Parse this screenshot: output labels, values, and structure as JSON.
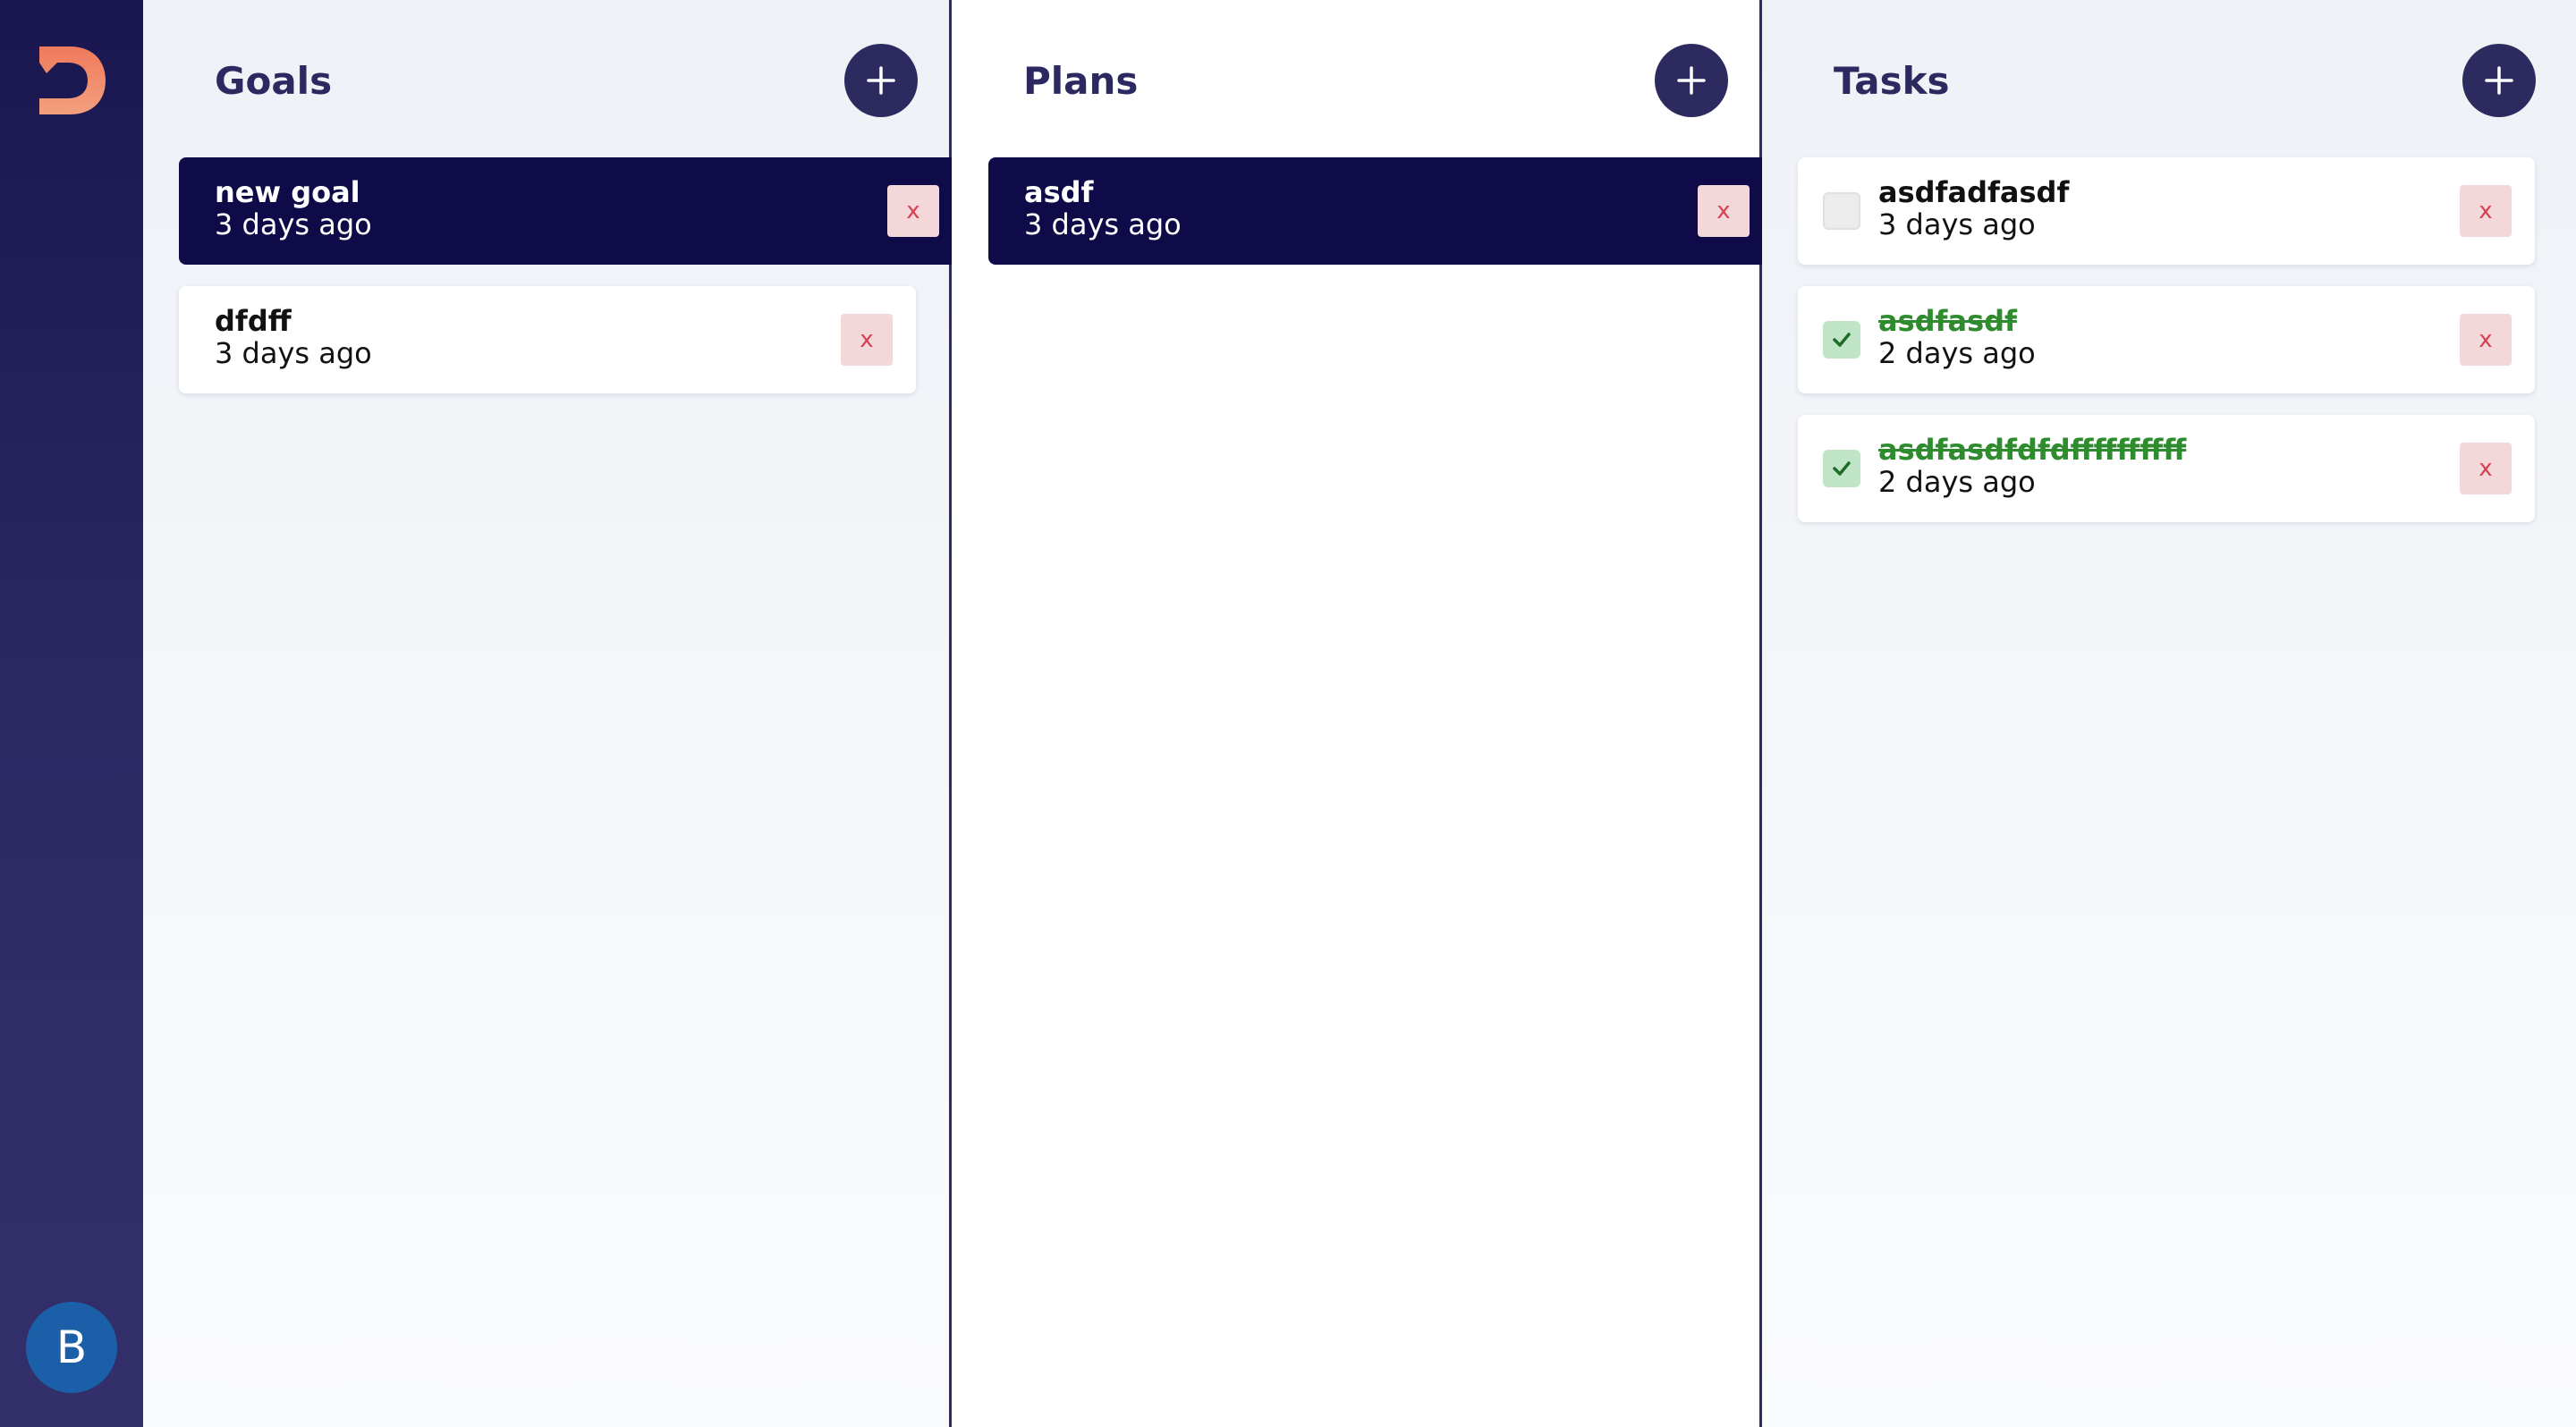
{
  "sidebar": {
    "logo_icon": "app-logo-icon",
    "avatar_letter": "B"
  },
  "goals": {
    "title": "Goals",
    "add_icon": "plus-icon",
    "items": [
      {
        "title": "new goal",
        "time": "3 days ago",
        "selected": true,
        "delete_label": "x"
      },
      {
        "title": "dfdff",
        "time": "3 days ago",
        "selected": false,
        "delete_label": "x"
      }
    ]
  },
  "plans": {
    "title": "Plans",
    "add_icon": "plus-icon",
    "items": [
      {
        "title": "asdf",
        "time": "3 days ago",
        "selected": true,
        "delete_label": "x"
      }
    ]
  },
  "tasks": {
    "title": "Tasks",
    "add_icon": "plus-icon",
    "items": [
      {
        "title": "asdfadfasdf",
        "time": "3 days ago",
        "done": false,
        "delete_label": "x"
      },
      {
        "title": "asdfasdf",
        "time": "2 days ago",
        "done": true,
        "delete_label": "x"
      },
      {
        "title": "asdfasdfdfdffffffffff",
        "time": "2 days ago",
        "done": true,
        "delete_label": "x"
      }
    ]
  },
  "colors": {
    "sidebar": "#1a1650",
    "accent": "#2d2a60",
    "selected_card": "#0f0a48",
    "logo": "#f08a6a",
    "avatar": "#1a5fa8",
    "done_text": "#2e8b2e",
    "delete_bg": "#f3d7d9",
    "delete_text": "#d8404f"
  }
}
